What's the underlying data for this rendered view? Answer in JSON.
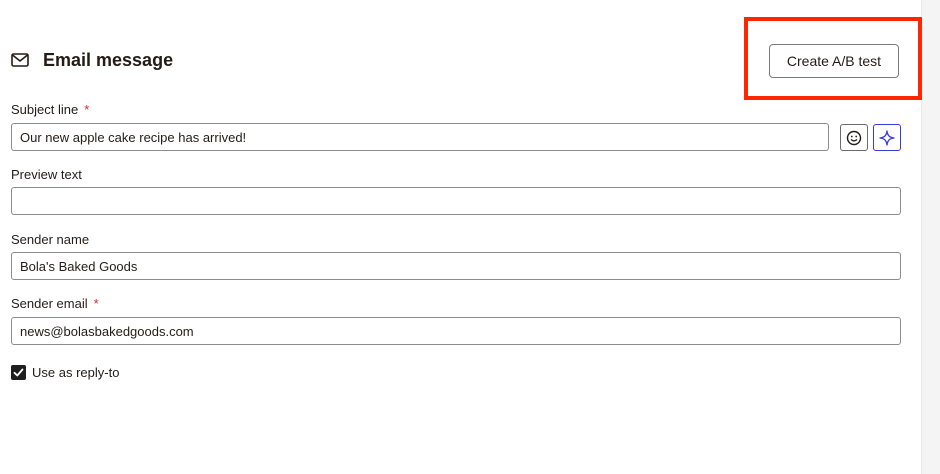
{
  "header": {
    "title": "Email message",
    "icon": "mail-icon",
    "ab_button_label": "Create A/B test"
  },
  "fields": {
    "subject": {
      "label": "Subject line",
      "required_mark": "*",
      "value": "Our new apple cake recipe has arrived!"
    },
    "preview": {
      "label": "Preview text",
      "value": ""
    },
    "sender_name": {
      "label": "Sender name",
      "value": "Bola's Baked Goods"
    },
    "sender_email": {
      "label": "Sender email",
      "required_mark": "*",
      "value": "news@bolasbakedgoods.com"
    }
  },
  "reply_to": {
    "label": "Use as reply-to",
    "checked": true
  },
  "colors": {
    "highlight": "#ff2600",
    "required": "#d8262b",
    "ai_accent": "#3b3bd6"
  }
}
